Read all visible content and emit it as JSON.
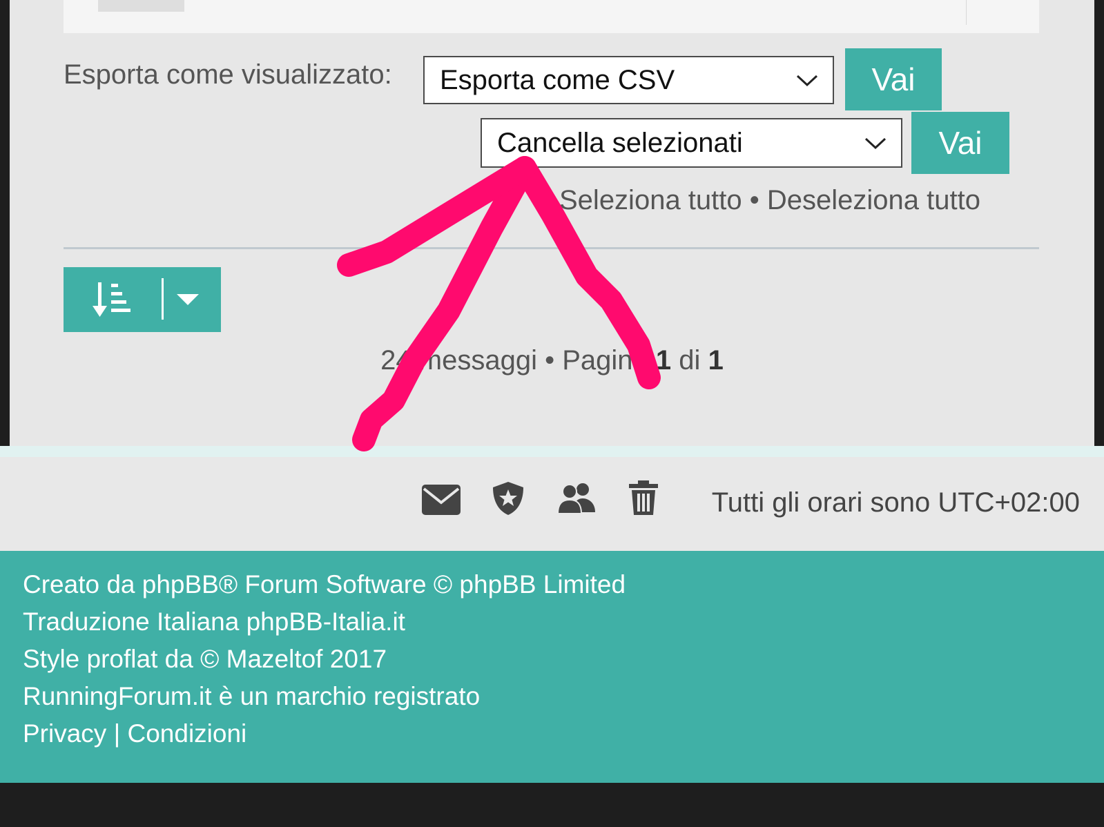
{
  "export": {
    "label": "Esporta come visualizzato:",
    "selected": "Esporta come CSV",
    "button": "Vai"
  },
  "moderation": {
    "selected": "Cancella selezionati",
    "button": "Vai"
  },
  "selection": {
    "select_all": "Seleziona tutto",
    "separator": "•",
    "deselect_all": "Deseleziona tutto"
  },
  "sort": {
    "icon": "sort-amount-down-icon",
    "dropdown_icon": "caret-down-icon"
  },
  "pagination": {
    "count": "24 messaggi",
    "separator": "•",
    "page_word": "Pagina",
    "current": "1",
    "of_word": "di",
    "total": "1"
  },
  "footer_bar": {
    "icons": [
      "envelope-icon",
      "shield-icon",
      "users-icon",
      "trash-icon"
    ],
    "timezone": "Tutti gli orari sono UTC+02:00"
  },
  "footer": {
    "credit": "Creato da phpBB® Forum Software © phpBB Limited",
    "translation": "Traduzione Italiana phpBB-Italia.it",
    "style": "Style proflat da © Mazeltof 2017",
    "trademark": "RunningForum.it è un marchio registrato",
    "privacy": "Privacy",
    "divider": "|",
    "terms": "Condizioni"
  },
  "colors": {
    "accent": "#40b0a6",
    "annotation": "#ff0a6e",
    "panel": "#e7e7e7",
    "dark_bottom": "#1e1e1e"
  }
}
